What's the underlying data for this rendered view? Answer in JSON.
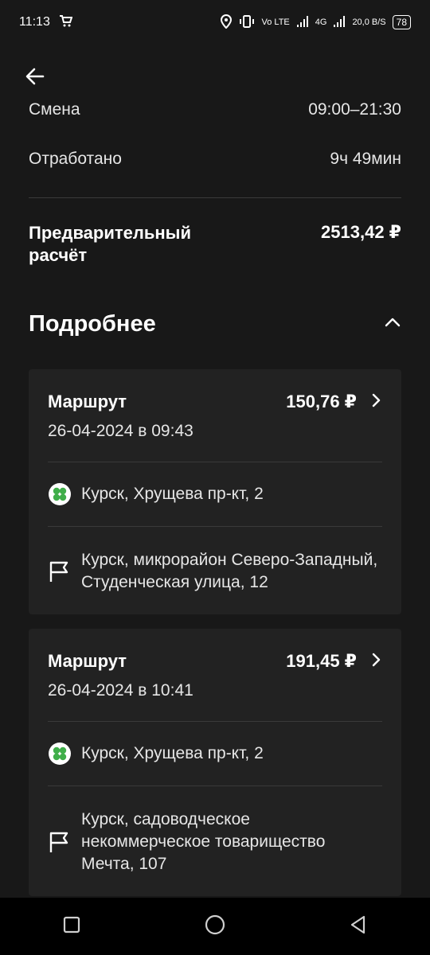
{
  "status_bar": {
    "time": "11:13",
    "network": "Vo LTE",
    "signal_label": "4G",
    "speed": "20,0 B/S",
    "battery": "78"
  },
  "summary": {
    "shift_label": "Смена",
    "shift_value": "09:00–21:30",
    "worked_label": "Отработано",
    "worked_value": "9ч 49мин",
    "pre_label": "Предварительный расчёт",
    "pre_value": "2513,42 ₽"
  },
  "details": {
    "title": "Подробнее"
  },
  "routes": [
    {
      "title": "Маршрут",
      "price": "150,76 ₽",
      "date": "26-04-2024 в 09:43",
      "from": "Курск, Хрущева пр-кт, 2",
      "to": "Курск, микрорайон Северо-Западный, Студенческая улица, 12"
    },
    {
      "title": "Маршрут",
      "price": "191,45 ₽",
      "date": "26-04-2024 в 10:41",
      "from": "Курск, Хрущева пр-кт, 2",
      "to": "Курск, садоводческое некоммерческое товарищество Мечта, 107"
    }
  ],
  "colors": {
    "background": "#181818",
    "card": "#222222",
    "divider": "#3a3a3a",
    "accent_green": "#3fae49"
  }
}
